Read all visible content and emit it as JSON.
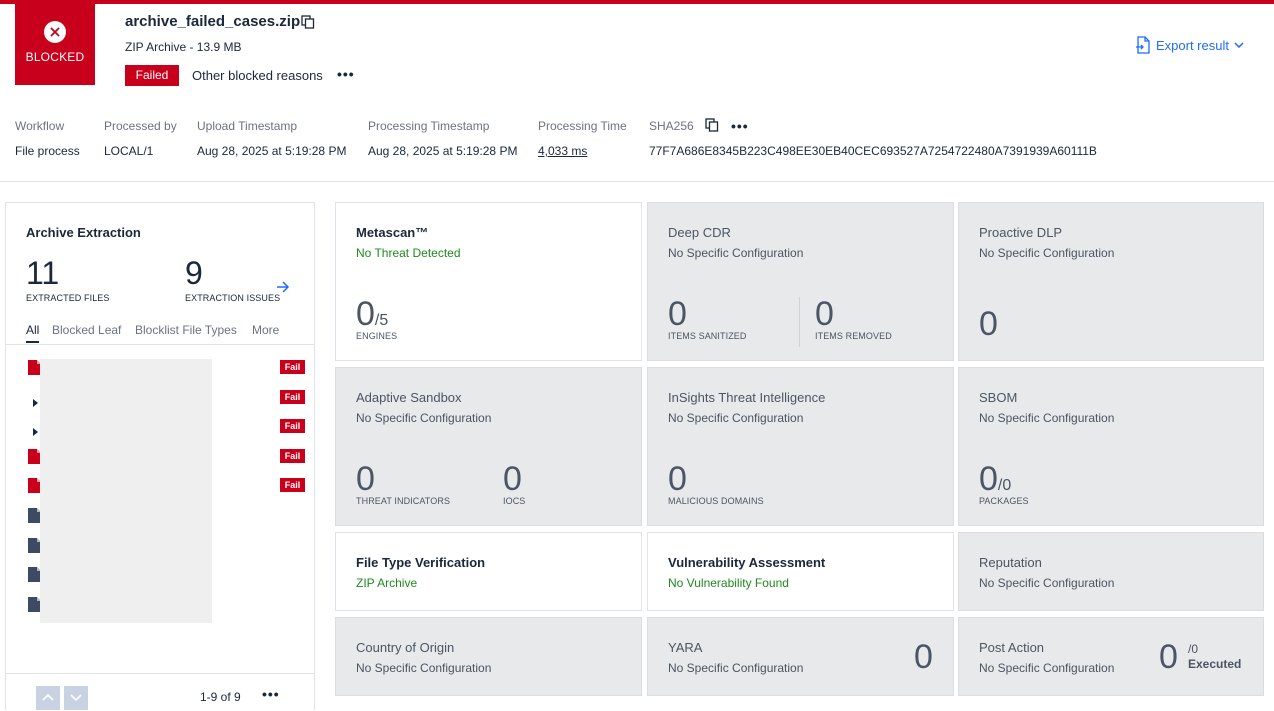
{
  "header": {
    "verdict": "BLOCKED",
    "file_name": "archive_failed_cases.zip",
    "file_type": "ZIP Archive - 13.9 MB",
    "status_badge": "Failed",
    "status_reason": "Other blocked reasons",
    "export_label": "Export result",
    "accent_color": "#c9001c",
    "link_color": "#1d6bfc"
  },
  "meta": {
    "workflow_label": "Workflow",
    "workflow_value": "File process",
    "processed_by_label": "Processed by",
    "processed_by_value": "LOCAL/1",
    "upload_label": "Upload Timestamp",
    "upload_value": "Aug 28, 2025 at 5:19:28 PM",
    "processing_ts_label": "Processing Timestamp",
    "processing_ts_value": "Aug 28, 2025 at 5:19:28 PM",
    "processing_time_label": "Processing Time",
    "processing_time_value": "4,033 ms",
    "sha_label": "SHA256",
    "sha_value": "77F7A686E8345B223C498EE30EB40CEC693527A7254722480A7391939A60111B"
  },
  "archive": {
    "title": "Archive Extraction",
    "extracted_count": "11",
    "extracted_label": "EXTRACTED FILES",
    "issues_count": "9",
    "issues_label": "EXTRACTION ISSUES",
    "tabs": [
      "All",
      "Blocked Leaf",
      "Blocklist File Types",
      "More"
    ],
    "rows": [
      {
        "icon": "red",
        "expandable": false,
        "badge": "Fail"
      },
      {
        "icon": "none",
        "expandable": true,
        "badge": "Fail"
      },
      {
        "icon": "none",
        "expandable": true,
        "badge": "Fail"
      },
      {
        "icon": "red",
        "expandable": false,
        "badge": "Fail"
      },
      {
        "icon": "red",
        "expandable": false,
        "badge": "Fail"
      },
      {
        "icon": "dark",
        "expandable": false,
        "badge": ""
      },
      {
        "icon": "dark",
        "expandable": false,
        "badge": ""
      },
      {
        "icon": "dark",
        "expandable": false,
        "badge": ""
      },
      {
        "icon": "dark",
        "expandable": false,
        "badge": ""
      }
    ],
    "pager": "1-9 of 9"
  },
  "cards": {
    "metascan": {
      "title": "Metascan™",
      "sub": "No Threat Detected",
      "num": "0",
      "den": "/5",
      "cap": "ENGINES"
    },
    "deepcdr": {
      "title": "Deep CDR",
      "sub": "No Specific Configuration",
      "num1": "0",
      "cap1": "ITEMS SANITIZED",
      "num2": "0",
      "cap2": "ITEMS REMOVED"
    },
    "dlp": {
      "title": "Proactive DLP",
      "sub": "No Specific Configuration",
      "num": "0"
    },
    "sandbox": {
      "title": "Adaptive Sandbox",
      "sub": "No Specific Configuration",
      "num1": "0",
      "cap1": "THREAT INDICATORS",
      "num2": "0",
      "cap2": "IOCS"
    },
    "insights": {
      "title": "InSights Threat Intelligence",
      "sub": "No Specific Configuration",
      "num": "0",
      "cap": "MALICIOUS DOMAINS"
    },
    "sbom": {
      "title": "SBOM",
      "sub": "No Specific Configuration",
      "num": "0",
      "den": "/0",
      "cap": "PACKAGES"
    },
    "filetype": {
      "title": "File Type Verification",
      "sub": "ZIP Archive"
    },
    "vuln": {
      "title": "Vulnerability Assessment",
      "sub": "No Vulnerability Found"
    },
    "reputation": {
      "title": "Reputation",
      "sub": "No Specific Configuration"
    },
    "country": {
      "title": "Country of Origin",
      "sub": "No Specific Configuration"
    },
    "yara": {
      "title": "YARA",
      "sub": "No Specific Configuration",
      "num": "0"
    },
    "postaction": {
      "title": "Post Action",
      "sub": "No Specific Configuration",
      "num": "0",
      "den": "/0",
      "cap": "Executed"
    }
  }
}
